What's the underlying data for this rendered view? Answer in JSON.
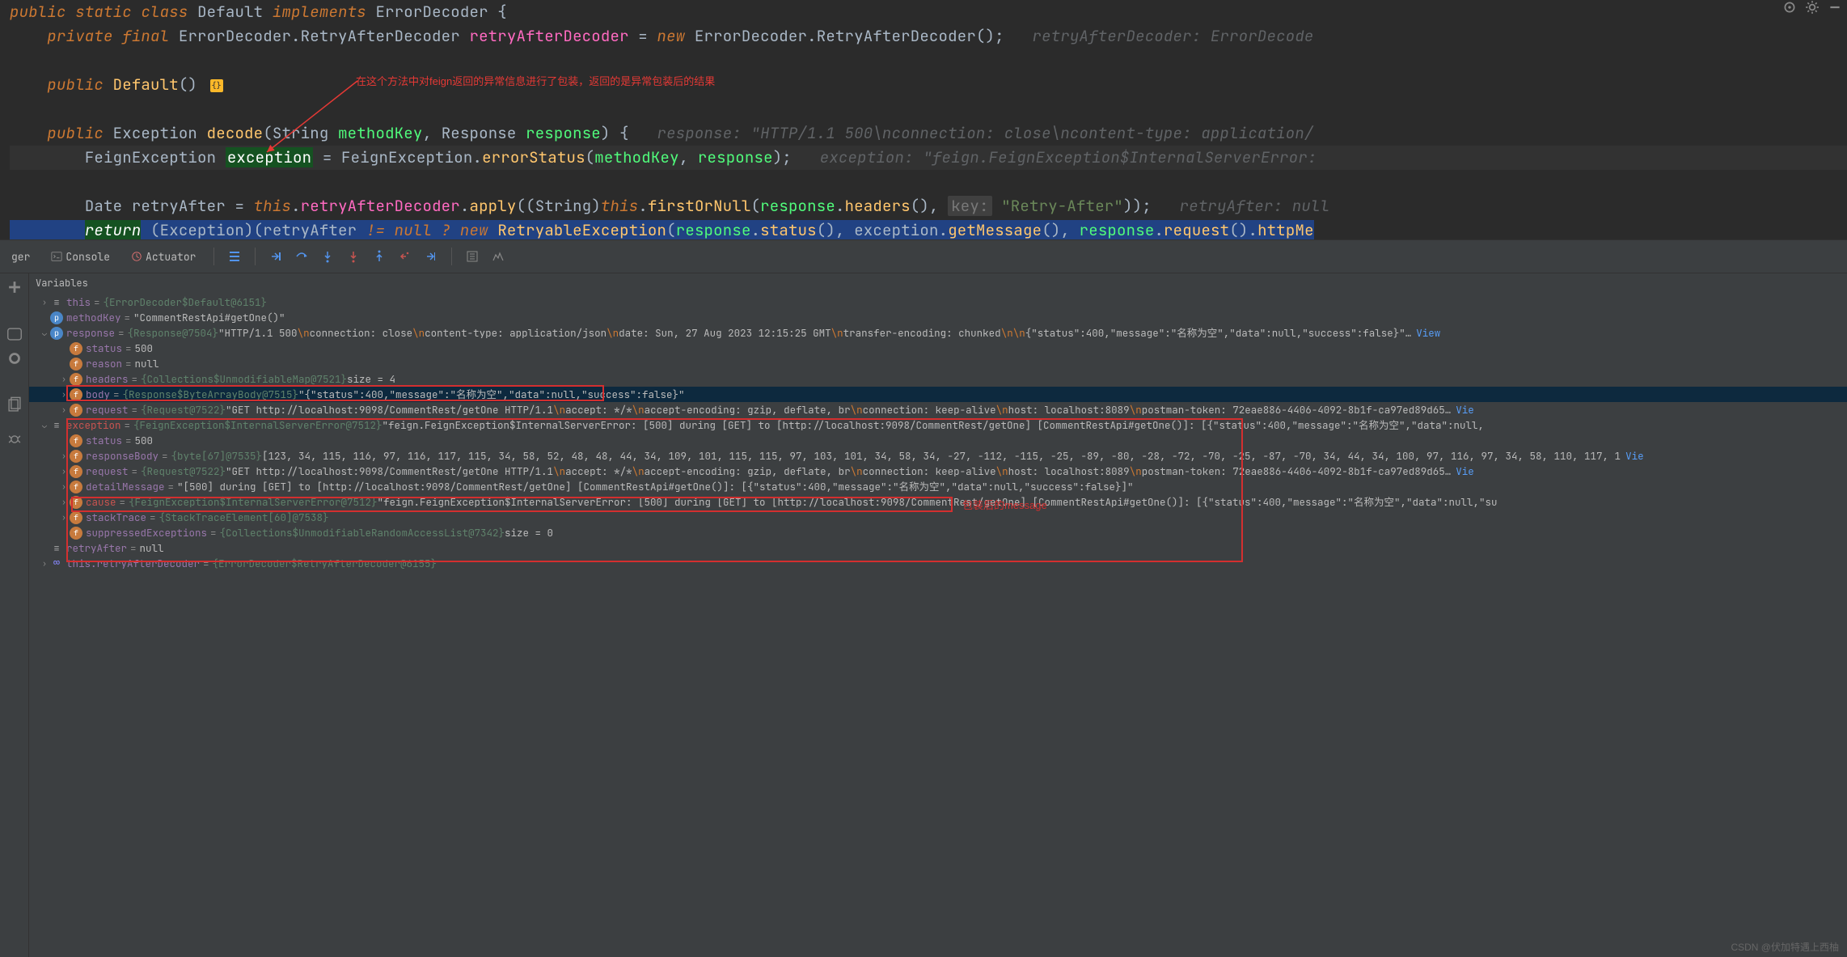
{
  "annotation_text": "在这个方法中对feign返回的异常信息进行了包装，返回的是异常包装后的结果",
  "code": {
    "line1": {
      "kw_public": "public",
      "kw_static": "static",
      "kw_class": "class",
      "name": "Default",
      "kw_implements": "implements",
      "iface": "ErrorDecoder"
    },
    "line2": {
      "kw_private": "private",
      "kw_final": "final",
      "t1": "ErrorDecoder",
      "t2": "RetryAfterDecoder",
      "field": "retryAfterDecoder",
      "kw_new": "new",
      "ctor1": "ErrorDecoder",
      "ctor2": "RetryAfterDecoder",
      "hint": "retryAfterDecoder: ErrorDecode"
    },
    "line3": {
      "kw_public": "public",
      "ctor": "Default"
    },
    "line4": {
      "kw_public": "public",
      "ret": "Exception",
      "name": "decode",
      "p1t": "String",
      "p1n": "methodKey",
      "p2t": "Response",
      "p2n": "response",
      "hint": "response: \"HTTP/1.1 500\\nconnection: close\\ncontent-type: application/"
    },
    "line5": {
      "t": "FeignException",
      "var": "exception",
      "call1": "FeignException",
      "call2": "errorStatus",
      "arg1": "methodKey",
      "arg2": "response",
      "hint": "exception: \"feign.FeignException$InternalServerError:"
    },
    "line6": {
      "t": "Date",
      "var": "retryAfter",
      "kw_this": "this",
      "f": "retryAfterDecoder",
      "m1": "apply",
      "cast": "String",
      "m2": "firstOrNull",
      "arg": "response",
      "m3": "headers",
      "hintlbl": "key:",
      "str": "\"Retry-After\"",
      "hint": "retryAfter: null"
    },
    "line7": {
      "kw_return": "return",
      "cast": "Exception",
      "var": "retryAfter",
      "op": "!=",
      "kw_null": "null",
      "q": "?",
      "kw_new": "new",
      "cls": "RetryableException",
      "a1": "response",
      "m1": "status",
      "a2": "exception",
      "m2": "getMessage",
      "a3": "response",
      "m3": "request",
      "tail": "httpMe"
    }
  },
  "toolbar": {
    "tab_debugger": "ger",
    "tab_console": "Console",
    "tab_actuator": "Actuator",
    "section_variables": "Variables"
  },
  "vars": {
    "this": {
      "name": "this",
      "type": "{ErrorDecoder$Default@6151}"
    },
    "methodKey": {
      "name": "methodKey",
      "val": "\"CommentRestApi#getOne()\""
    },
    "response": {
      "name": "response",
      "type": "{Response@7504}",
      "preview_a": "\"HTTP/1.1 500",
      "preview_b": "connection: close",
      "preview_c": "content-type: application/json",
      "preview_d": "date: Sun, 27 Aug 2023 12:15:25 GMT",
      "preview_e": "transfer-encoding: chunked",
      "preview_f": "{\"status\":400,\"message\":\"名称为空\",\"data\":null,\"success\":false}\"",
      "view": "View"
    },
    "status": {
      "name": "status",
      "val": "500"
    },
    "reason": {
      "name": "reason",
      "val": "null"
    },
    "headers": {
      "name": "headers",
      "type": "{Collections$UnmodifiableMap@7521}",
      "extra": "size = 4"
    },
    "body": {
      "name": "body",
      "type": "{Response$ByteArrayBody@7515}",
      "preview": "\"{\"status\":400,\"message\":\"名称为空\",\"data\":null,\"success\":false}\""
    },
    "request": {
      "name": "request",
      "type": "{Request@7522}",
      "preview_a": "\"GET http://localhost:9098/CommentRest/getOne HTTP/1.1",
      "preview_b": "accept: */*",
      "preview_c": "accept-encoding: gzip, deflate, br",
      "preview_d": "connection: keep-alive",
      "preview_e": "host: localhost:8089",
      "preview_f": "postman-token: 72eae886-4406-4092-8b1f-ca97ed89d65",
      "tail": "Vie"
    },
    "exception": {
      "name": "exception",
      "type": "{FeignException$InternalServerError@7512}",
      "preview": "\"feign.FeignException$InternalServerError: [500] during [GET] to [http://localhost:9098/CommentRest/getOne] [CommentRestApi#getOne()]: [{\"status\":400,\"message\":\"名称为空\",\"data\":null,"
    },
    "status2": {
      "name": "status",
      "val": "500"
    },
    "responseBody": {
      "name": "responseBody",
      "type": "{byte[67]@7535}",
      "preview": "[123, 34, 115, 116, 97, 116, 117, 115, 34, 58, 52, 48, 48, 44, 34, 109, 101, 115, 115, 97, 103, 101, 34, 58, 34, -27, -112, -115, -25, -89, -80, -28, -72, -70, -25, -87, -70, 34, 44, 34, 100, 97, 116, 97, 34, 58, 110, 117, 1",
      "tail": "Vie"
    },
    "request2": {
      "name": "request",
      "type": "{Request@7522}",
      "preview_a": "\"GET http://localhost:9098/CommentRest/getOne HTTP/1.1",
      "preview_b": "accept: */*",
      "preview_c": "accept-encoding: gzip, deflate, br",
      "preview_d": "connection: keep-alive",
      "preview_e": "host: localhost:8089",
      "preview_f": "postman-token: 72eae886-4406-4092-8b1f-ca97ed89d65",
      "tail": "Vie"
    },
    "detailMessage": {
      "name": "detailMessage",
      "val": "\"[500] during [GET] to [http://localhost:9098/CommentRest/getOne] [CommentRestApi#getOne()]: [{\"status\":400,\"message\":\"名称为空\",\"data\":null,\"success\":false}]\""
    },
    "cause": {
      "name": "cause",
      "type": "{FeignException$InternalServerError@7512}",
      "preview": "\"feign.FeignException$InternalServerError: [500] during [GET] to [http://localhost:9098/CommentRest/getOne] [CommentRestApi#getOne()]: [{\"status\":400,\"message\":\"名称为空\",\"data\":null,\"su"
    },
    "stackTrace": {
      "name": "stackTrace",
      "type": "{StackTraceElement[60]@7538}"
    },
    "suppressed": {
      "name": "suppressedExceptions",
      "type": "{Collections$UnmodifiableRandomAccessList@7342}",
      "extra": "size = 0"
    },
    "retryAfter": {
      "name": "retryAfter",
      "val": "null"
    },
    "retryDecoder": {
      "name": "this.retryAfterDecoder",
      "type": "{ErrorDecoder$RetryAfterDecoder@6155}"
    }
  },
  "red_note_msg": "包装后的message",
  "watermark": "CSDN @伏加特遇上西柚"
}
